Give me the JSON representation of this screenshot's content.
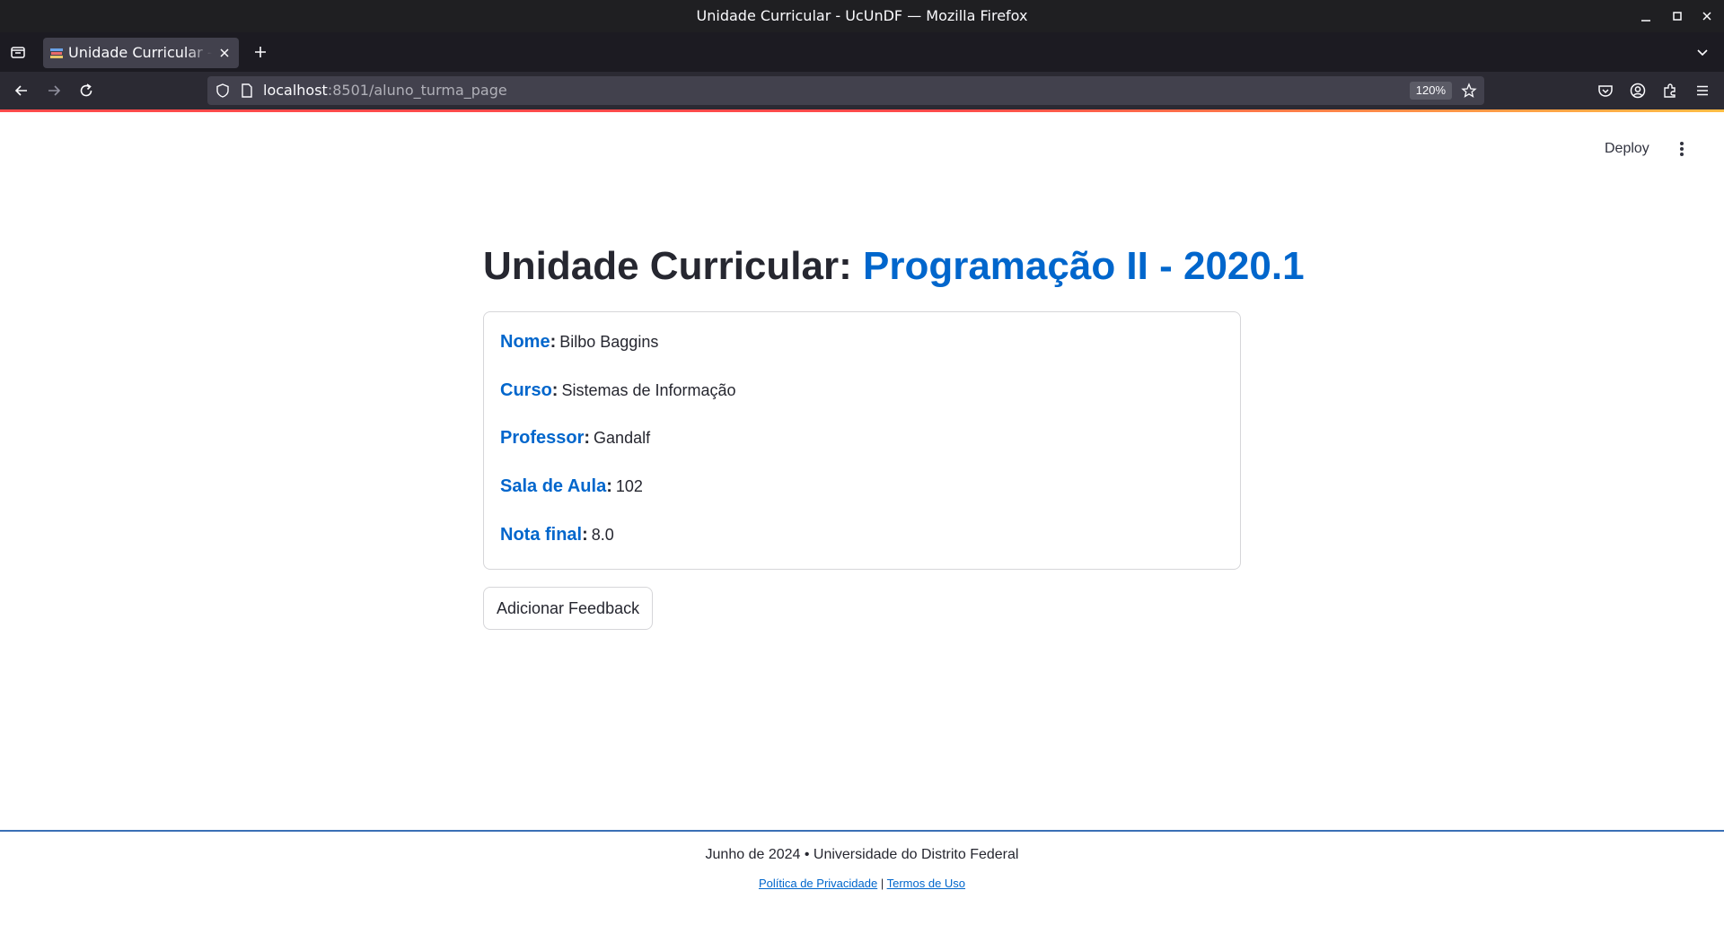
{
  "window": {
    "title": "Unidade Curricular - UcUnDF — Mozilla Firefox"
  },
  "tabs": [
    {
      "title": "Unidade Curricular - UcUnDF",
      "active": true
    }
  ],
  "navbar": {
    "url_host": "localhost",
    "url_path": ":8501/aluno_turma_page",
    "zoom": "120%"
  },
  "app_header": {
    "deploy_label": "Deploy",
    "menu_icon": "kebab-menu-icon"
  },
  "main": {
    "title_prefix": "Unidade Curricular: ",
    "title_course": "Programação II - 2020.1",
    "info": [
      {
        "label": "Nome",
        "value": "Bilbo Baggins"
      },
      {
        "label": "Curso",
        "value": "Sistemas de Informação"
      },
      {
        "label": "Professor",
        "value": "Gandalf"
      },
      {
        "label": "Sala de Aula",
        "value": "102"
      },
      {
        "label": "Nota final",
        "value": "8.0"
      }
    ],
    "feedback_button": "Adicionar Feedback"
  },
  "footer": {
    "text": "Junho de 2024 • Universidade do Distrito Federal",
    "privacy_link": "Política de Privacidade",
    "separator": "|",
    "terms_link": "Termos de Uso"
  },
  "colors": {
    "accent": "#0066cc",
    "footer_line": "#3a6fb5",
    "loading_bar": "#ff4b4b"
  }
}
